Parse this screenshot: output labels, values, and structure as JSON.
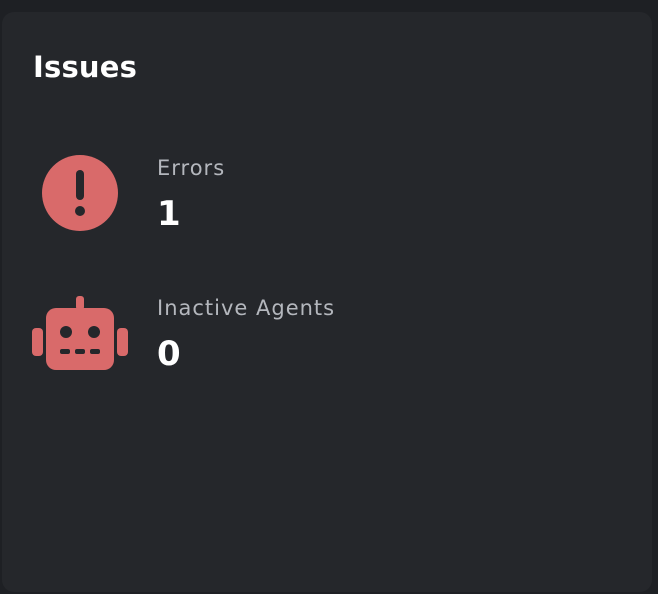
{
  "card": {
    "title": "Issues"
  },
  "issues": [
    {
      "label": "Errors",
      "value": "1",
      "icon": "exclamation-circle-icon"
    },
    {
      "label": "Inactive Agents",
      "value": "0",
      "icon": "robot-icon"
    }
  ],
  "colors": {
    "background": "#1e2024",
    "card": "#25272b",
    "accent": "#d96a6a",
    "title": "#ffffff",
    "label": "#b4b7bd"
  }
}
